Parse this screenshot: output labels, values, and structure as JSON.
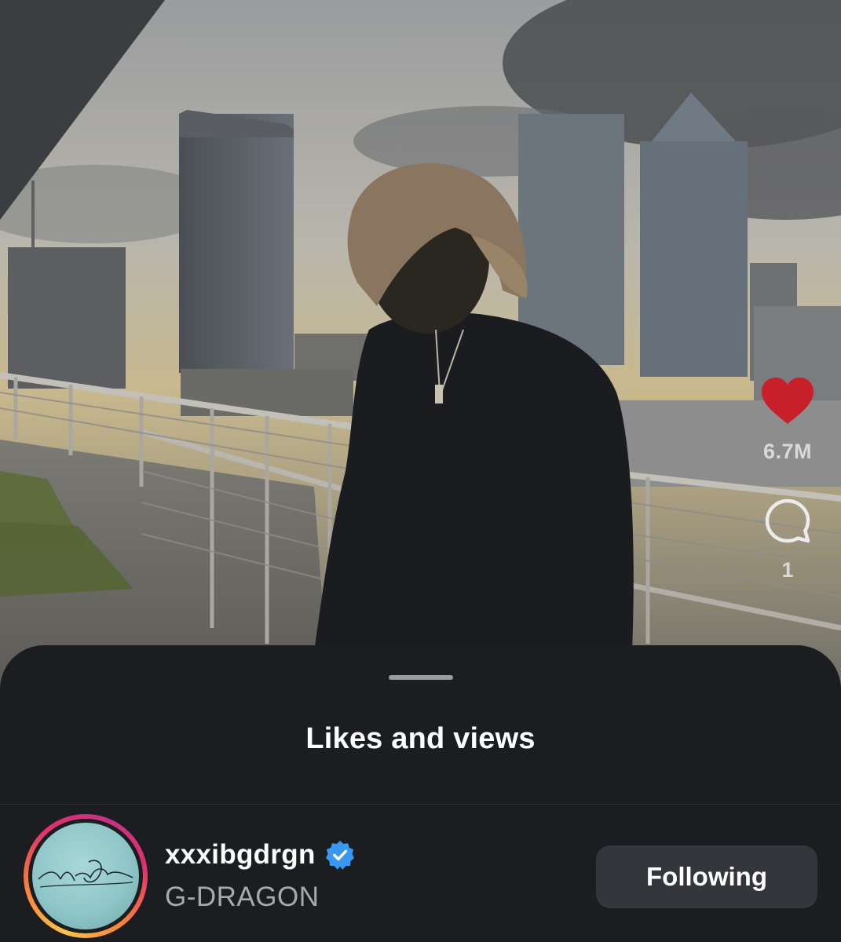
{
  "reel": {
    "like_count": "6.7M",
    "comment_count": "1",
    "like_icon": "heart-filled-icon",
    "comment_icon": "comment-bubble-icon",
    "like_color": "#c8202a"
  },
  "sheet": {
    "title": "Likes and views"
  },
  "user": {
    "username": "xxxibgdrgn",
    "verified_icon": "verified-badge-icon",
    "verified_color": "#3897f0",
    "full_name": "G-DRAGON",
    "avatar_signature": "Monsieur G-Dragon",
    "follow_button_label": "Following"
  }
}
